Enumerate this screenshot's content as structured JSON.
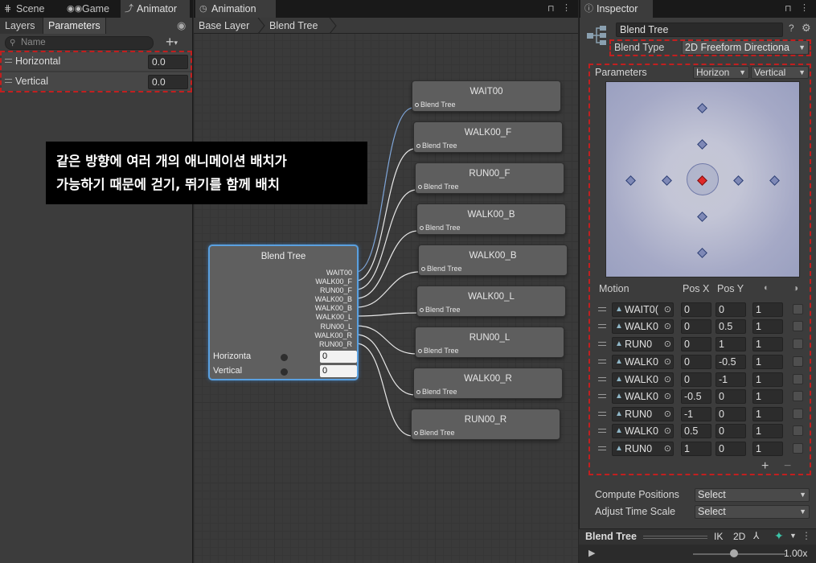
{
  "left_panel": {
    "tabs": [
      {
        "label": "Scene",
        "icon": "grid-icon"
      },
      {
        "label": "Game",
        "icon": "gamepad-icon"
      },
      {
        "label": "Animator",
        "icon": "animator-icon"
      }
    ],
    "subtabs": [
      "Layers",
      "Parameters"
    ],
    "search_placeholder": "Name",
    "parameters": [
      {
        "name": "Horizontal",
        "value": "0.0"
      },
      {
        "name": "Vertical",
        "value": "0.0"
      }
    ]
  },
  "animation_panel": {
    "tab": "Animation",
    "breadcrumb": [
      "Base Layer",
      "Blend Tree"
    ],
    "blend_node": {
      "title": "Blend Tree",
      "outputs": [
        "WAIT00",
        "WALK00_F",
        "RUN00_F",
        "WALK00_B",
        "WALK00_B",
        "WALK00_L",
        "RUN00_L",
        "WALK00_R",
        "RUN00_R"
      ],
      "params": [
        {
          "name": "Horizontal",
          "display": "Horizonta",
          "value": "0"
        },
        {
          "name": "Vertical",
          "display": "Vertical",
          "value": "0"
        }
      ]
    },
    "clip_nodes": [
      {
        "title": "WAIT00",
        "sub": "Blend Tree"
      },
      {
        "title": "WALK00_F",
        "sub": "Blend Tree"
      },
      {
        "title": "RUN00_F",
        "sub": "Blend Tree"
      },
      {
        "title": "WALK00_B",
        "sub": "Blend Tree"
      },
      {
        "title": "WALK00_B",
        "sub": "Blend Tree"
      },
      {
        "title": "WALK00_L",
        "sub": "Blend Tree"
      },
      {
        "title": "RUN00_L",
        "sub": "Blend Tree"
      },
      {
        "title": "WALK00_R",
        "sub": "Blend Tree"
      },
      {
        "title": "RUN00_R",
        "sub": "Blend Tree"
      }
    ],
    "caption": [
      "같은 방향에 여러 개의 애니메이션 배치가",
      "가능하기 때문에 걷기, 뛰기를 함께 배치"
    ]
  },
  "inspector": {
    "tab": "Inspector",
    "name": "Blend Tree",
    "blend_type_label": "Blend Type",
    "blend_type_value": "2D Freeform Directiona",
    "parameters_label": "Parameters",
    "param_x": "Horizon",
    "param_y": "Vertical",
    "motion_header": {
      "motion": "Motion",
      "pos_x": "Pos X",
      "pos_y": "Pos Y"
    },
    "motions": [
      {
        "clip": "WAIT0(",
        "x": "0",
        "y": "0",
        "speed": "1"
      },
      {
        "clip": "WALK0",
        "x": "0",
        "y": "0.5",
        "speed": "1"
      },
      {
        "clip": "RUN0",
        "x": "0",
        "y": "1",
        "speed": "1"
      },
      {
        "clip": "WALK0",
        "x": "0",
        "y": "-0.5",
        "speed": "1"
      },
      {
        "clip": "WALK0",
        "x": "0",
        "y": "-1",
        "speed": "1"
      },
      {
        "clip": "WALK0",
        "x": "-0.5",
        "y": "0",
        "speed": "1"
      },
      {
        "clip": "RUN0",
        "x": "-1",
        "y": "0",
        "speed": "1"
      },
      {
        "clip": "WALK0",
        "x": "0.5",
        "y": "0",
        "speed": "1"
      },
      {
        "clip": "RUN0",
        "x": "1",
        "y": "0",
        "speed": "1"
      }
    ],
    "compute_positions_label": "Compute Positions",
    "compute_positions_value": "Select",
    "adjust_time_scale_label": "Adjust Time Scale",
    "adjust_time_scale_value": "Select",
    "preview_title": "Blend Tree",
    "preview_buttons": [
      "IK",
      "2D"
    ],
    "playback_speed": "1.00x"
  },
  "colors": {
    "highlight_dash": "#c21f1f",
    "selection_blue": "#5aa0e0",
    "blend_point": "#7e88b6",
    "blend_point_active": "#e02828"
  }
}
